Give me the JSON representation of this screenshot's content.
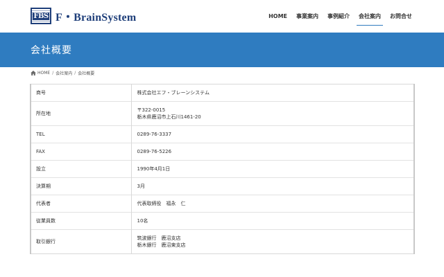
{
  "site": {
    "logo_mark": "FBS",
    "logo_text": "F・BrainSystem"
  },
  "nav": {
    "items": [
      {
        "label": "HOME",
        "active": false
      },
      {
        "label": "事業案内",
        "active": false
      },
      {
        "label": "事例紹介",
        "active": false
      },
      {
        "label": "会社案内",
        "active": true
      },
      {
        "label": "お問合せ",
        "active": false
      }
    ]
  },
  "page": {
    "title": "会社概要",
    "accent_color": "#2f7cc0"
  },
  "breadcrumb": {
    "home_icon": "home-icon",
    "items": [
      "HOME",
      "会社案内",
      "会社概要"
    ],
    "separator": "/"
  },
  "company_table": {
    "rows": [
      {
        "label": "商号",
        "lines": [
          "株式会社エフ・ブレーンシステム"
        ]
      },
      {
        "label": "所在地",
        "lines": [
          "〒322-0015",
          "栃木県鹿沼市上石川1461-20"
        ]
      },
      {
        "label": "TEL",
        "lines": [
          "0289-76-3337"
        ]
      },
      {
        "label": "FAX",
        "lines": [
          "0289-76-5226"
        ]
      },
      {
        "label": "設立",
        "lines": [
          "1990年4月1日"
        ]
      },
      {
        "label": "決算期",
        "lines": [
          "3月"
        ]
      },
      {
        "label": "代表者",
        "lines": [
          "代表取締役　福永　仁"
        ]
      },
      {
        "label": "従業員数",
        "lines": [
          "10名"
        ]
      },
      {
        "label": "取引銀行",
        "lines": [
          "筑波銀行　鹿沼支店",
          "栃木銀行　鹿沼東支店"
        ]
      }
    ]
  }
}
